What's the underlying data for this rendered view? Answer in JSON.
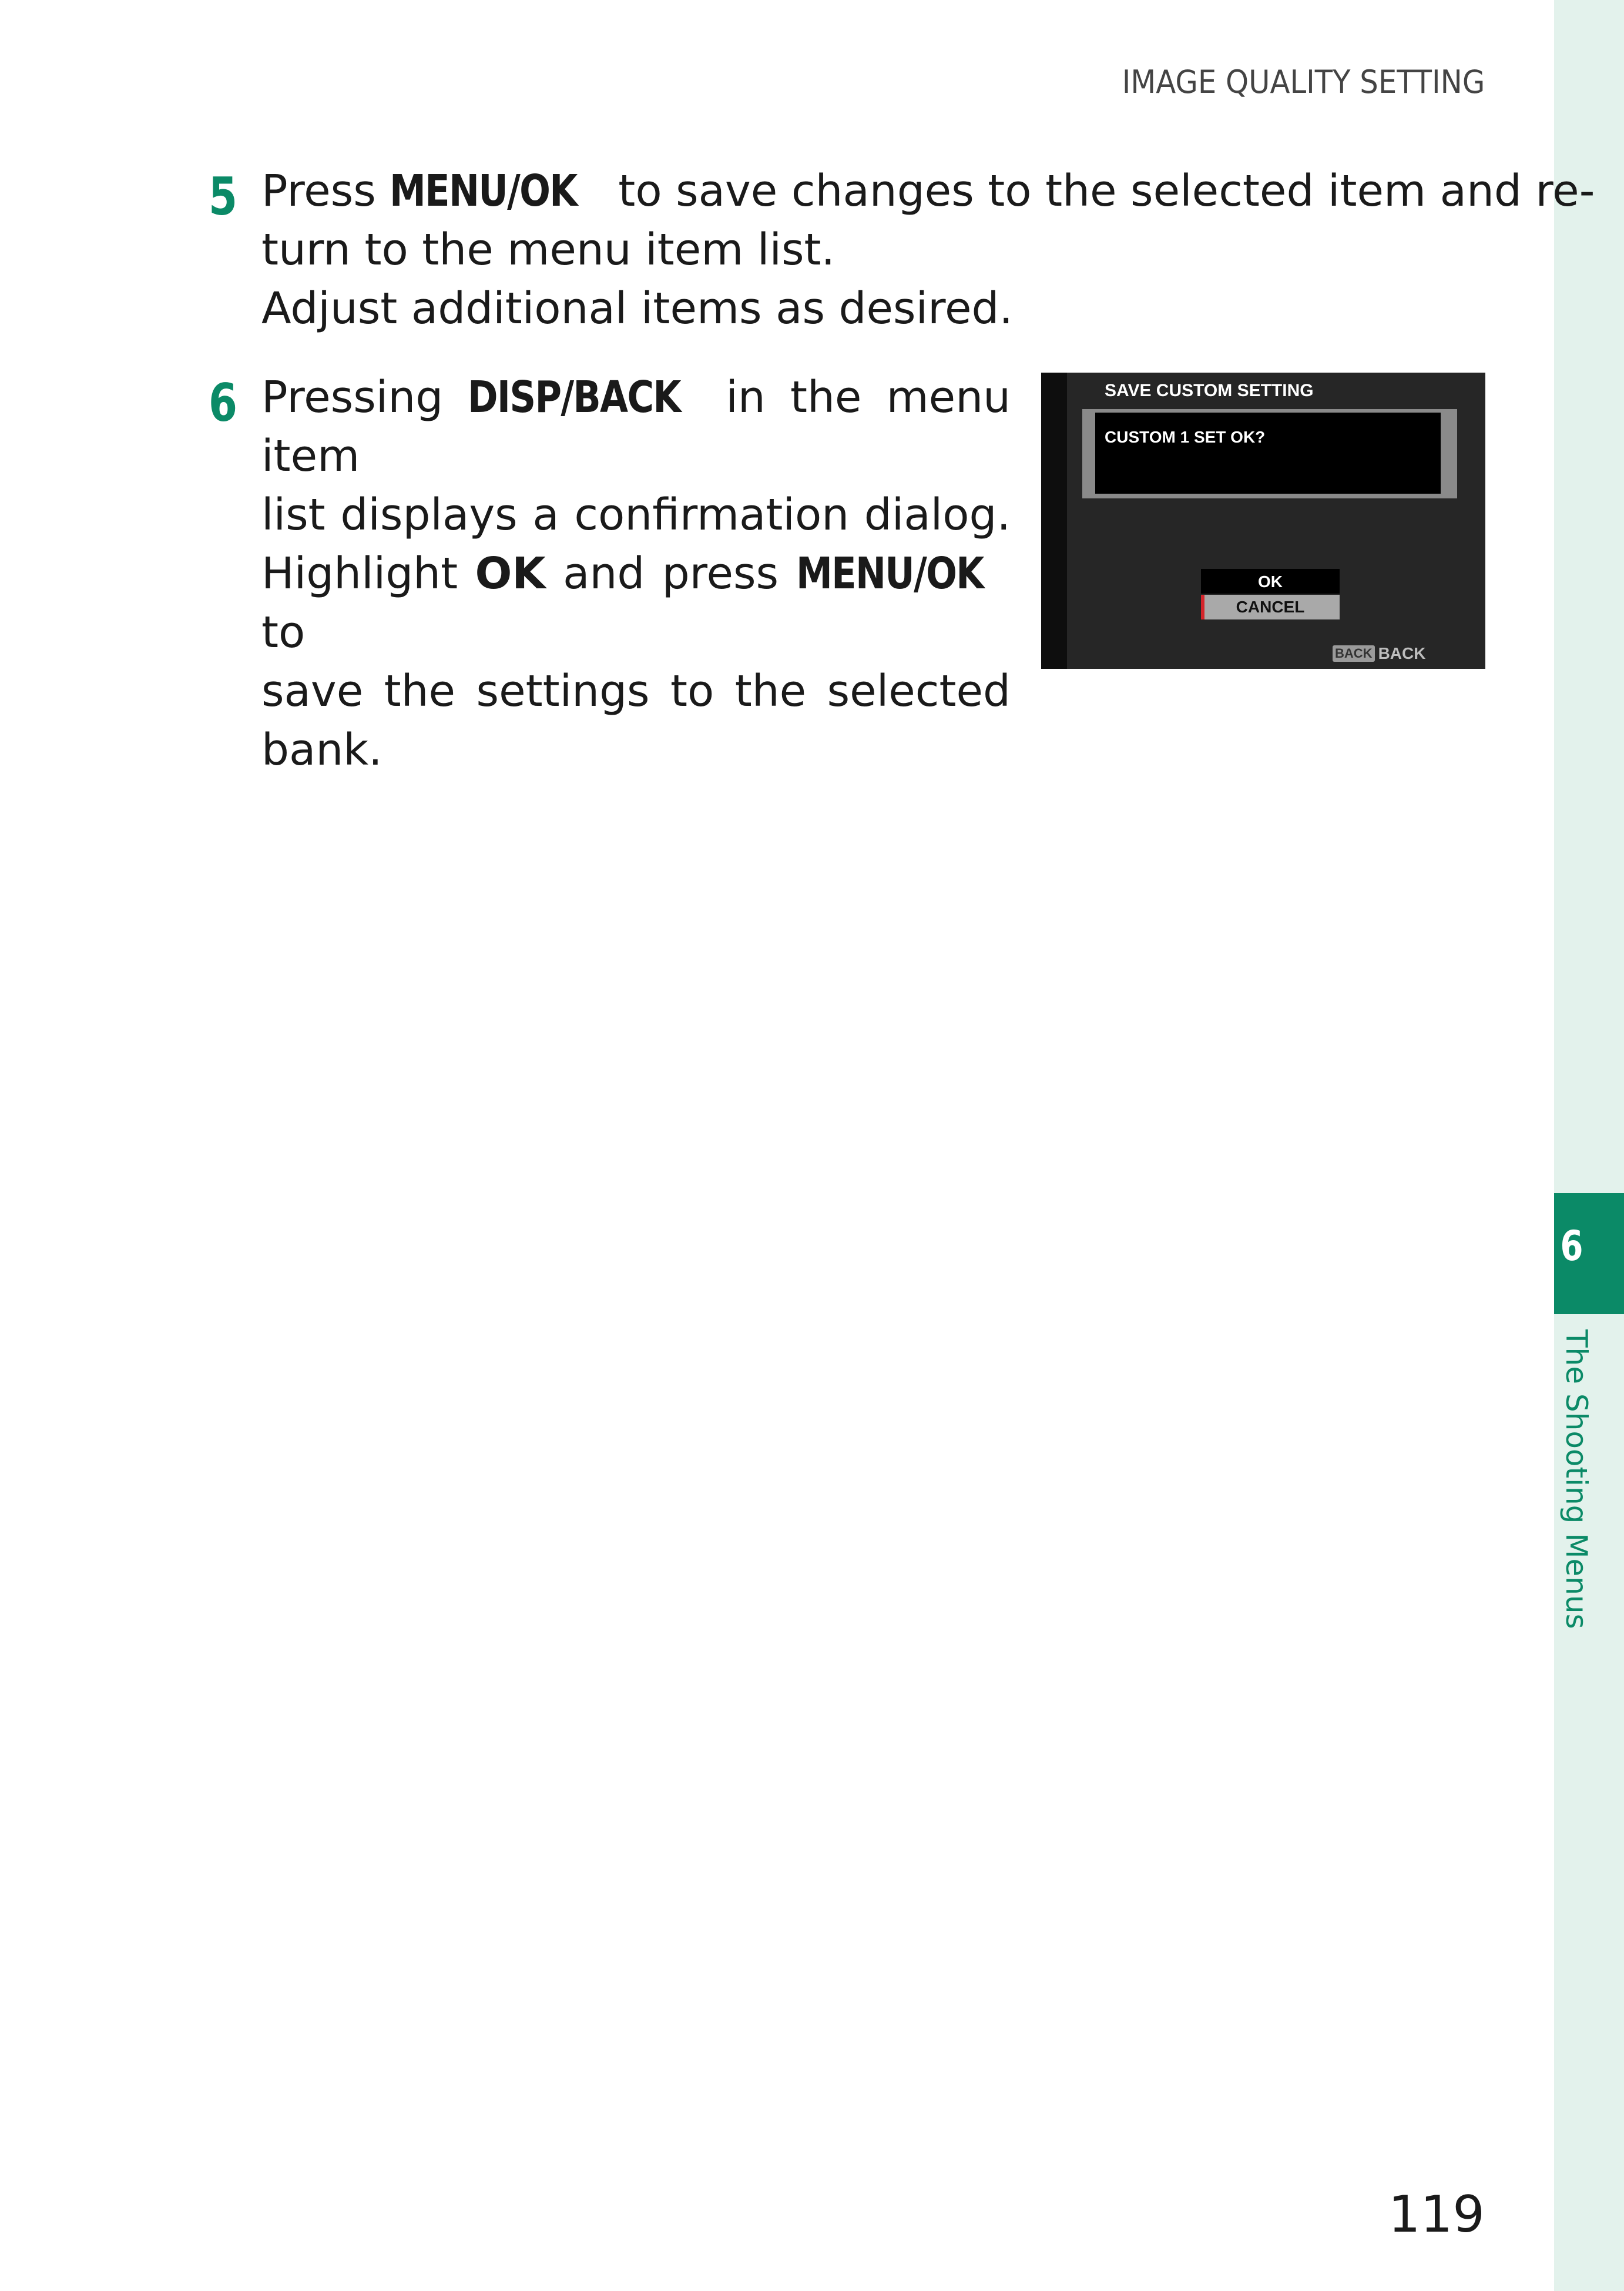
{
  "header": {
    "section": "IMAGE QUALITY SETTING"
  },
  "steps": [
    {
      "number": "5",
      "lines": [
        {
          "a": "Press ",
          "key": "MENU/OK",
          "b": " to save changes to the selected item and re-"
        },
        {
          "text": "turn to the menu item list."
        },
        {
          "text": "Adjust additional items as desired."
        }
      ]
    },
    {
      "number": "6",
      "line1": {
        "a": "Pressing ",
        "key": "DISP/BACK",
        "b": " in the menu item"
      },
      "line2": "list displays a confirmation dialog.",
      "line3": {
        "a": "Highlight ",
        "ok": "OK",
        "b": " and press ",
        "key": "MENU/OK",
        "c": " to"
      },
      "line4": "save the settings to the selected",
      "line5": "bank."
    }
  ],
  "screen": {
    "title": "SAVE CUSTOM SETTING",
    "message": "CUSTOM 1 SET OK?",
    "options": [
      "OK",
      "CANCEL"
    ],
    "selected_option": "CANCEL",
    "back_chip": "BACK",
    "back_label": "BACK",
    "colors": {
      "background": "#262626",
      "highlight_marker": "#d4242a"
    }
  },
  "sidebar": {
    "chapter_number": "6",
    "chapter_title": "The Shooting Menus",
    "accent_color": "#0b8a67",
    "strip_color": "#e3f2ec"
  },
  "page_number": "119"
}
